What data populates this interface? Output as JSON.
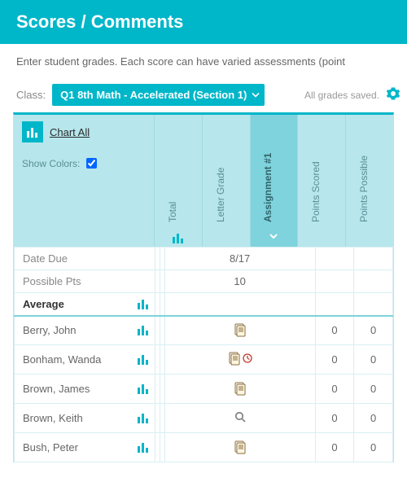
{
  "header": {
    "title": "Scores / Comments"
  },
  "intro": "Enter student grades. Each score can have varied assessments (point",
  "toolbar": {
    "class_label": "Class:",
    "class_value": "Q1 8th Math - Accelerated (Section 1)",
    "saved_text": "All grades saved."
  },
  "controls": {
    "chart_all": "Chart All",
    "show_colors_label": "Show Colors:",
    "show_colors_checked": true
  },
  "columns": [
    {
      "key": "total",
      "label": "Total"
    },
    {
      "key": "letter",
      "label": "Letter Grade"
    },
    {
      "key": "assign1",
      "label": "Assignment #1",
      "active": true
    },
    {
      "key": "pts_scored",
      "label": "Points Scored"
    },
    {
      "key": "pts_possible",
      "label": "Points Possible"
    }
  ],
  "meta_rows": {
    "date_due_label": "Date Due",
    "possible_pts_label": "Possible Pts",
    "average_label": "Average",
    "date_due": {
      "assign1": "8/17"
    },
    "possible_pts": {
      "assign1": "10"
    }
  },
  "students": [
    {
      "name": "Berry, John",
      "assign_icon": "paper",
      "pts_scored": "0",
      "pts_possible": "0"
    },
    {
      "name": "Bonham, Wanda",
      "assign_icon": "paper-clock",
      "pts_scored": "0",
      "pts_possible": "0"
    },
    {
      "name": "Brown, James",
      "assign_icon": "paper",
      "pts_scored": "0",
      "pts_possible": "0"
    },
    {
      "name": "Brown, Keith",
      "assign_icon": "magnifier",
      "pts_scored": "0",
      "pts_possible": "0"
    },
    {
      "name": "Bush, Peter",
      "assign_icon": "paper",
      "pts_scored": "0",
      "pts_possible": "0"
    }
  ]
}
